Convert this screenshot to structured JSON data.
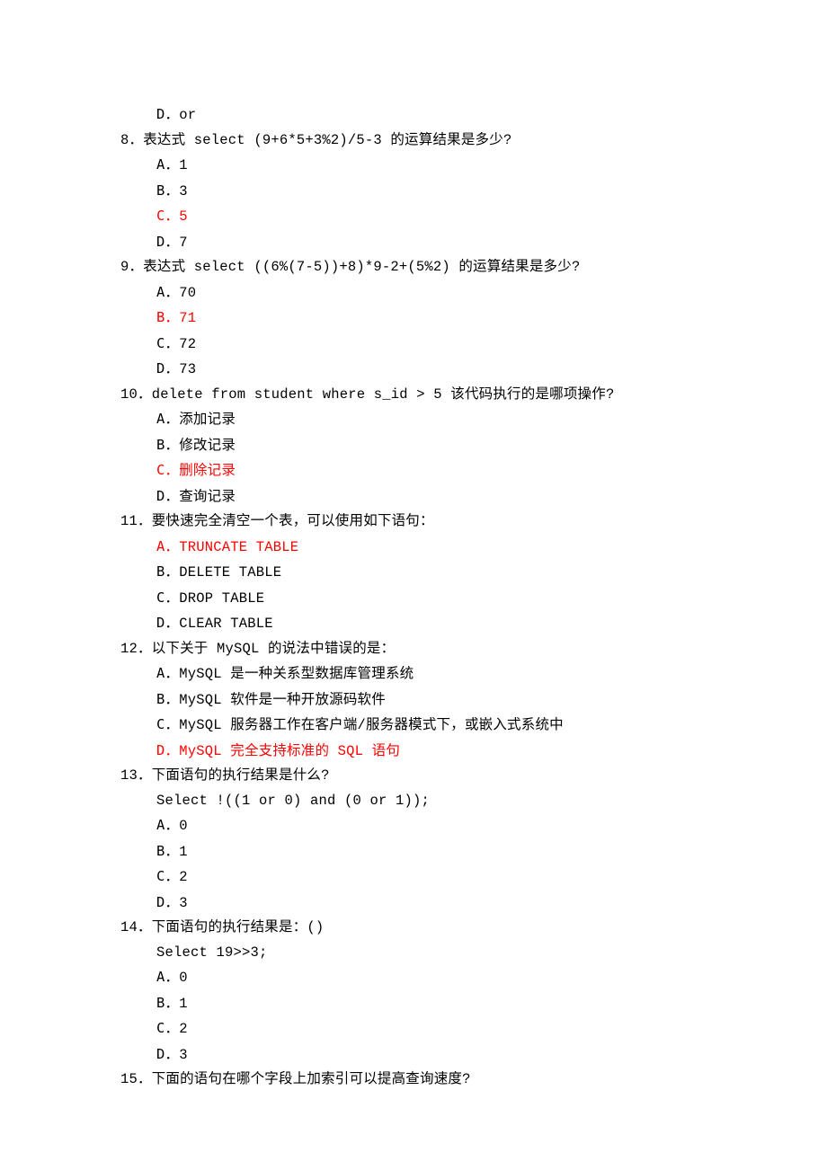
{
  "q7_remnant_opts": [
    {
      "label": "D．",
      "text": "or",
      "red": false
    }
  ],
  "questions": [
    {
      "num": "8．",
      "stem": "表达式 select (9+6*5+3%2)/5-3 的运算结果是多少?",
      "code": null,
      "opts": [
        {
          "label": "A．",
          "text": "1",
          "red": false
        },
        {
          "label": "B．",
          "text": "3",
          "red": false
        },
        {
          "label": "C．",
          "text": "5",
          "red": true
        },
        {
          "label": "D．",
          "text": "7",
          "red": false
        }
      ]
    },
    {
      "num": "9．",
      "stem": "表达式 select ((6%(7-5))+8)*9-2+(5%2) 的运算结果是多少?",
      "code": null,
      "opts": [
        {
          "label": "A．",
          "text": "70",
          "red": false
        },
        {
          "label": "B．",
          "text": "71",
          "red": true
        },
        {
          "label": "C．",
          "text": "72",
          "red": false
        },
        {
          "label": "D．",
          "text": "73",
          "red": false
        }
      ]
    },
    {
      "num": "10．",
      "stem": "delete from student where s_id > 5 该代码执行的是哪项操作?",
      "code": null,
      "opts": [
        {
          "label": "A．",
          "text": "添加记录",
          "red": false
        },
        {
          "label": "B．",
          "text": "修改记录",
          "red": false
        },
        {
          "label": "C．",
          "text": "删除记录",
          "red": true
        },
        {
          "label": "D．",
          "text": "查询记录",
          "red": false
        }
      ]
    },
    {
      "num": "11．",
      "stem": "要快速完全清空一个表，可以使用如下语句：",
      "code": null,
      "opts": [
        {
          "label": "A．",
          "text": "TRUNCATE TABLE",
          "red": true
        },
        {
          "label": "B．",
          "text": "DELETE TABLE",
          "red": false
        },
        {
          "label": "C．",
          "text": "DROP TABLE",
          "red": false
        },
        {
          "label": "D．",
          "text": "CLEAR TABLE",
          "red": false
        }
      ]
    },
    {
      "num": "12．",
      "stem": "以下关于 MySQL 的说法中错误的是：",
      "code": null,
      "opts": [
        {
          "label": "A．",
          "text": "MySQL 是一种关系型数据库管理系统",
          "red": false
        },
        {
          "label": "B．",
          "text": "MySQL 软件是一种开放源码软件",
          "red": false
        },
        {
          "label": "C．",
          "text": "MySQL 服务器工作在客户端/服务器模式下，或嵌入式系统中",
          "red": false
        },
        {
          "label": "D．",
          "text": "MySQL 完全支持标准的 SQL 语句",
          "red": true
        }
      ]
    },
    {
      "num": "13．",
      "stem": "下面语句的执行结果是什么?",
      "code": "Select  !((1 or 0) and (0 or 1));",
      "opts": [
        {
          "label": "A．",
          "text": "0",
          "red": false
        },
        {
          "label": "B．",
          "text": "1",
          "red": false
        },
        {
          "label": "C．",
          "text": "2",
          "red": false
        },
        {
          "label": "D．",
          "text": "3",
          "red": false
        }
      ]
    },
    {
      "num": "14．",
      "stem": "下面语句的执行结果是：()",
      "code": "Select 19>>3;",
      "opts": [
        {
          "label": "A．",
          "text": "0",
          "red": false
        },
        {
          "label": "B．",
          "text": "1",
          "red": false
        },
        {
          "label": "C．",
          "text": "2",
          "red": false
        },
        {
          "label": "D．",
          "text": "3",
          "red": false
        }
      ]
    },
    {
      "num": "15．",
      "stem": "下面的语句在哪个字段上加索引可以提高查询速度?",
      "code": null,
      "opts": []
    }
  ]
}
